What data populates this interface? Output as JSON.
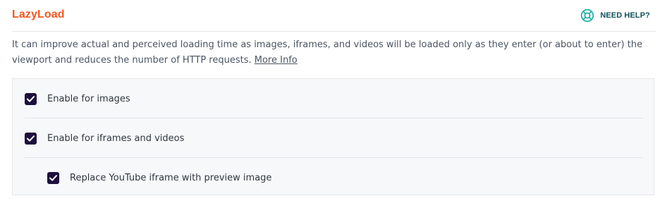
{
  "header": {
    "title": "LazyLoad",
    "help_label": "NEED HELP?",
    "help_icon": "lifebuoy-icon"
  },
  "description": {
    "text": "It can improve actual and perceived loading time as images, iframes, and videos will be loaded only as they enter (or about to enter) the viewport and reduces the number of HTTP requests.",
    "link_label": "More Info"
  },
  "options": [
    {
      "label": "Enable for images",
      "checked": true,
      "indent": 0
    },
    {
      "label": "Enable for iframes and videos",
      "checked": true,
      "indent": 0
    },
    {
      "label": "Replace YouTube iframe with preview image",
      "checked": true,
      "indent": 1
    }
  ],
  "colors": {
    "title": "#f3571f",
    "help": "#0b4f5a",
    "checkbox": "#1c0f3c",
    "panel_bg": "#f7f8fa"
  }
}
